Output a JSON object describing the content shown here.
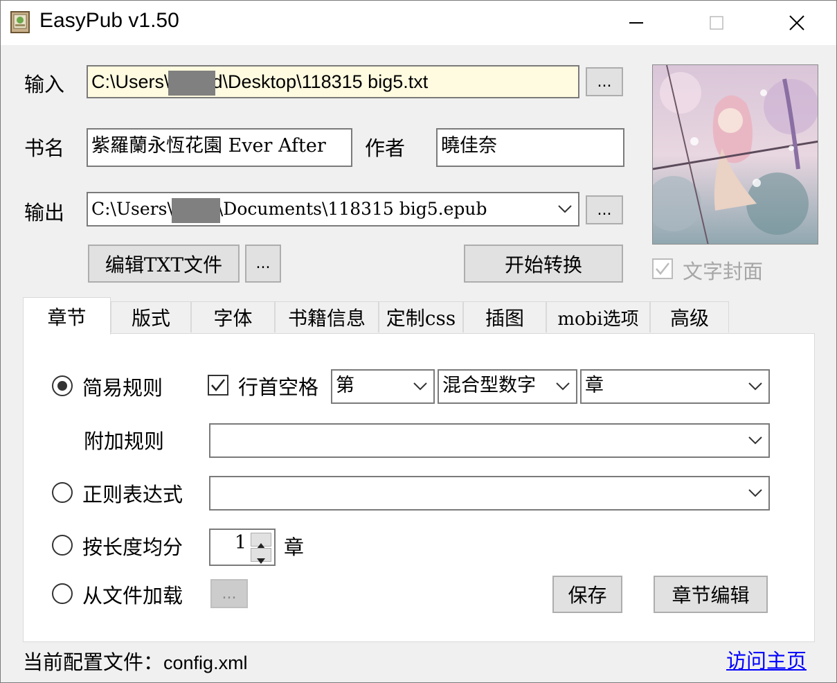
{
  "window": {
    "title": "EasyPub v1.50"
  },
  "titlebar": {
    "minimize_icon": "minimize-icon",
    "maximize_icon": "maximize-icon",
    "close_icon": "close-icon"
  },
  "input": {
    "label": "输入",
    "path_prefix": "C:\\Users\\",
    "path_suffix": "d\\Desktop\\118315 big5.txt",
    "browse_label": "..."
  },
  "book": {
    "title_label": "书名",
    "title_value": "紫羅蘭永恆花園 Ever After",
    "author_label": "作者",
    "author_value": "曉佳奈"
  },
  "output": {
    "label": "输出",
    "path_prefix": "C:\\Users\\",
    "path_suffix": "\\Documents\\118315 big5.epub",
    "browse_label": "..."
  },
  "actions": {
    "edit_txt": "编辑TXT文件",
    "edit_more": "...",
    "start": "开始转换"
  },
  "cover": {
    "text_cover_label": "文字封面",
    "text_cover_checked": true
  },
  "tabs": [
    "章节",
    "版式",
    "字体",
    "书籍信息",
    "定制css",
    "插图",
    "mobi选项",
    "高级"
  ],
  "chapter": {
    "simple_rule_label": "简易规则",
    "leading_space_label": "行首空格",
    "leading_space_checked": true,
    "prefix_value": "第",
    "number_type_value": "混合型数字",
    "suffix_value": "章",
    "extra_rule_label": "附加规则",
    "extra_rule_value": "",
    "regex_label": "正则表达式",
    "regex_value": "",
    "split_by_length_label": "按长度均分",
    "split_count": "1",
    "split_unit": "章",
    "load_from_file_label": "从文件加载",
    "load_browse_label": "...",
    "save_label": "保存",
    "chapter_edit_label": "章节编辑",
    "selected_mode": "简易规则"
  },
  "footer": {
    "config_label": "当前配置文件：",
    "config_file": "config.xml",
    "homepage_link": "访问主页"
  },
  "colors": {
    "input_highlight": "#fffbe0",
    "link": "#0000ff",
    "button_face": "#e1e1e1"
  }
}
